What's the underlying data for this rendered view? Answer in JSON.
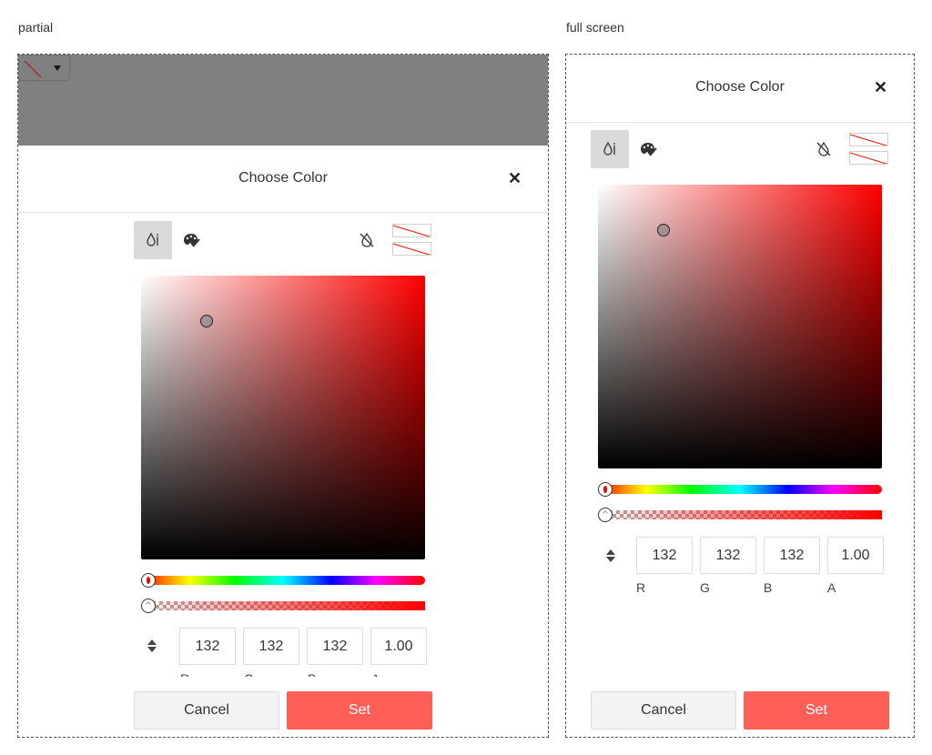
{
  "captions": {
    "left": "partial",
    "right": "full screen"
  },
  "dialog": {
    "title": "Choose Color",
    "close_glyph": "✕",
    "tabs": [
      {
        "name": "picker",
        "icon": "drop-plus-icon",
        "active": true
      },
      {
        "name": "palette",
        "icon": "palette-icon",
        "active": false
      }
    ],
    "toggle_icon": "drop-off-icon",
    "preview": {
      "current": "none",
      "previous": "none"
    },
    "color": {
      "hue": 0,
      "saturation_pct": 23,
      "value_pct": 84,
      "alpha": 0
    },
    "fields": [
      {
        "label": "R",
        "value": "132"
      },
      {
        "label": "G",
        "value": "132"
      },
      {
        "label": "B",
        "value": "132"
      },
      {
        "label": "A",
        "value": "1.00"
      }
    ],
    "buttons": {
      "cancel": "Cancel",
      "set": "Set"
    }
  },
  "colors": {
    "accent": "#ff5f57",
    "overlay": "#808080",
    "none_line": "#ff0000"
  }
}
